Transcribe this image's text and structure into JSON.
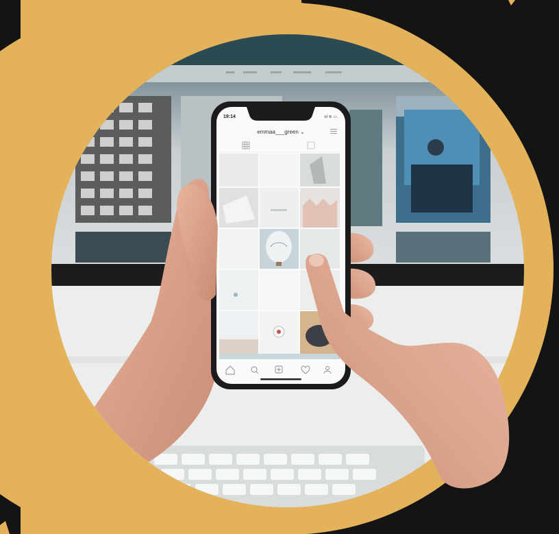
{
  "scene": {
    "subject": "hands holding smartphone with photo grid app",
    "accent_ring_color": "#E3B25A",
    "background_color": "#141414"
  },
  "phone": {
    "status_time": "19:14",
    "status_right": "ııl ≋ ▭",
    "profile_name": "emmaa___green ⌄",
    "icons": {
      "grid_tab": "grid-icon",
      "tagged_tab": "tagged-icon",
      "menu": "menu-icon",
      "nav": [
        "home-icon",
        "search-icon",
        "add-icon",
        "heart-icon",
        "profile-icon"
      ]
    }
  }
}
